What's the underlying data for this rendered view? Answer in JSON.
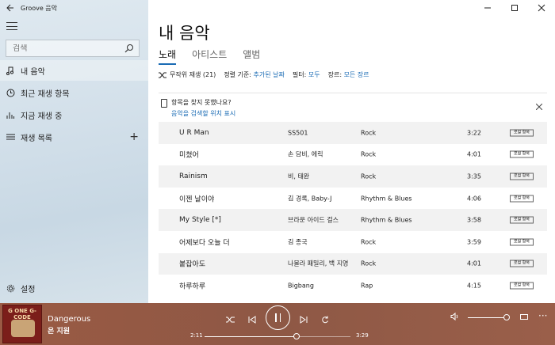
{
  "app": {
    "title": "Groove 음악"
  },
  "sidebar": {
    "search_placeholder": "검색",
    "items": [
      {
        "label": "내 음악",
        "icon": "music-note-icon"
      },
      {
        "label": "최근 재생 항목",
        "icon": "clock-icon"
      },
      {
        "label": "지금 재생 중",
        "icon": "bars-icon"
      },
      {
        "label": "재생 목록",
        "icon": "list-icon",
        "add": "+"
      }
    ],
    "settings_label": "설정"
  },
  "main": {
    "title": "내 음악",
    "tabs": [
      {
        "label": "노래",
        "active": true
      },
      {
        "label": "아티스트",
        "active": false
      },
      {
        "label": "앨범",
        "active": false
      }
    ],
    "filter": {
      "shuffle": "무작위 재생 (21)",
      "sort_label": "정렬 기준:",
      "sort_value": "추가된 날짜",
      "filter_label": "필터:",
      "filter_value": "모두",
      "genre_label": "장르:",
      "genre_value": "모든 장르"
    },
    "notice": {
      "title": "항목을 찾지 못했나요?",
      "link": "음악을 검색할 위치 표시"
    },
    "badge_text": "로컬 항목",
    "songs": [
      {
        "title": "U R Man",
        "artist": "SS501",
        "genre": "Rock",
        "duration": "3:22"
      },
      {
        "title": "미쳤어",
        "artist": "손 담비, 에릭",
        "genre": "Rock",
        "duration": "4:01"
      },
      {
        "title": "Rainism",
        "artist": "비, 태완",
        "genre": "Rock",
        "duration": "3:35"
      },
      {
        "title": "이젠 날이야",
        "artist": "김 경록, Baby-J",
        "genre": "Rhythm & Blues",
        "duration": "4:06"
      },
      {
        "title": "My Style [*]",
        "artist": "브라운 아이드 걸스",
        "genre": "Rhythm & Blues",
        "duration": "3:58"
      },
      {
        "title": "어제보다 오늘 더",
        "artist": "김 종국",
        "genre": "Rock",
        "duration": "3:59"
      },
      {
        "title": "붙잡아도",
        "artist": "나몰라 패밀리, 백 지영",
        "genre": "Rock",
        "duration": "4:01"
      },
      {
        "title": "하루하루",
        "artist": "Bigbang",
        "genre": "Rap",
        "duration": "4:15"
      }
    ]
  },
  "player": {
    "track": "Dangerous",
    "artist": "은 지원",
    "album_art_text": "G ONE G-CODE",
    "elapsed": "2:11",
    "total": "3:29",
    "progress": 0.63,
    "volume": 0.95
  },
  "colors": {
    "accent": "#1a6bb4",
    "player_bg": "#8f5845"
  }
}
